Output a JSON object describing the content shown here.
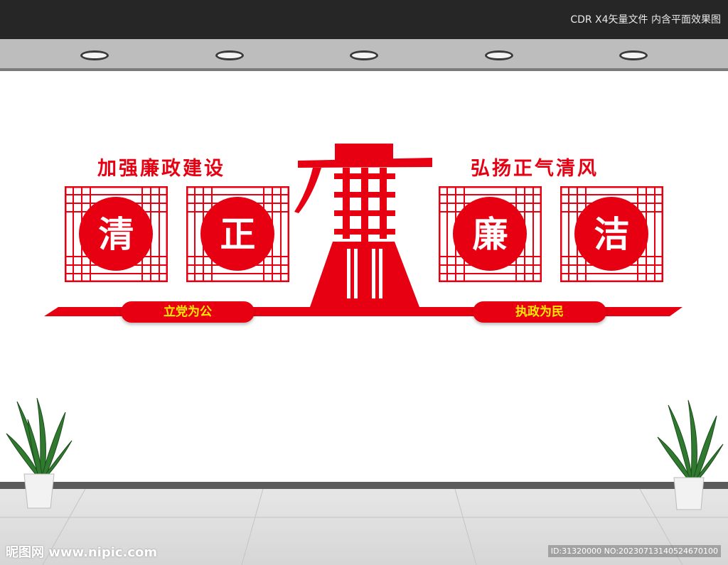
{
  "header": {
    "file_info": "CDR X4矢量文件  内含平面效果图"
  },
  "slogans": {
    "left": "加强廉政建设",
    "right": "弘扬正气清风"
  },
  "panels": [
    {
      "char": "清"
    },
    {
      "char": "正"
    },
    {
      "char": "廉"
    },
    {
      "char": "洁"
    }
  ],
  "pills": {
    "left": "立党为公",
    "right": "执政为民"
  },
  "watermark": {
    "site": "昵图网 www.nipic.com",
    "id": "ID:31320000 NO:20230713140524670100"
  },
  "colors": {
    "accent_red": "#e60012",
    "pill_text": "#ffea00",
    "topbar": "#262626"
  }
}
